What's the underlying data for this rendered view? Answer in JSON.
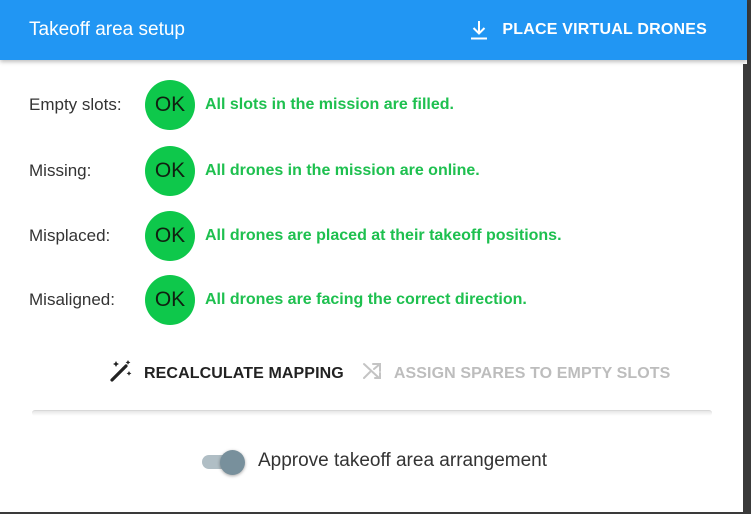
{
  "header": {
    "title": "Takeoff area setup",
    "action_label": "PLACE VIRTUAL DRONES",
    "action_icon": "download-icon"
  },
  "checks": [
    {
      "label": "Empty slots:",
      "status": "OK",
      "message": "All slots in the mission are filled."
    },
    {
      "label": "Missing:",
      "status": "OK",
      "message": "All drones in the mission are online."
    },
    {
      "label": "Misplaced:",
      "status": "OK",
      "message": "All drones are placed at their takeoff positions."
    },
    {
      "label": "Misaligned:",
      "status": "OK",
      "message": "All drones are facing the correct direction."
    }
  ],
  "actions": {
    "recalculate": {
      "label": "RECALCULATE MAPPING",
      "icon": "magic-wand-icon"
    },
    "assign_spares": {
      "label": "ASSIGN SPARES TO EMPTY SLOTS",
      "icon": "shuffle-icon",
      "disabled": true
    }
  },
  "footer": {
    "toggle_label": "Approve takeoff area arrangement",
    "toggle_on": true
  },
  "colors": {
    "header": "#2196f3",
    "ok_badge": "#0ec84b",
    "ok_text": "#1ec04f",
    "disabled_text": "#bdbdbd"
  }
}
